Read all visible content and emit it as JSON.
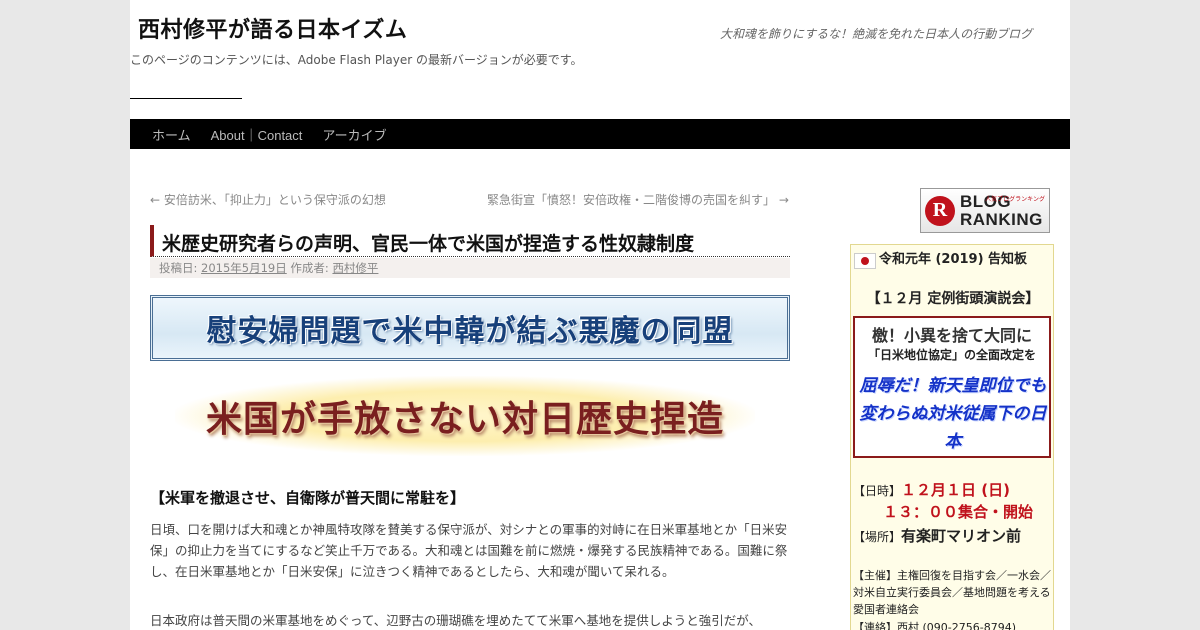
{
  "header": {
    "site_title": "西村修平が語る日本イズム",
    "site_description": "大和魂を飾りにするな！絶滅を免れた日本人の行動ブログ",
    "flash_message": "このページのコンテンツには、Adobe Flash Player の最新バージョンが必要です。"
  },
  "nav": {
    "items": [
      {
        "label": "ホーム"
      },
      {
        "label": "About｜Contact"
      },
      {
        "label": "アーカイブ"
      }
    ]
  },
  "post_nav": {
    "previous": "← 安倍訪米、「抑止力」という保守派の幻想",
    "next": "緊急街宣「憤怒！安倍政権・二階俊博の売国を糾す」 →"
  },
  "post": {
    "title": "米歴史研究者らの声明、官民一体で米国が捏造する性奴隷制度",
    "meta_prefix": "投稿日:",
    "date": "2015年5月19日",
    "author_prefix": "作成者:",
    "author": "西村修平",
    "banner1": "慰安婦問題で米中韓が結ぶ悪魔の同盟",
    "banner2": "米国が手放さない対日歴史捏造",
    "section_heading": "【米軍を撤退させ、自衛隊が普天間に常駐を】",
    "paragraph1": "日頃、口を開けば大和魂とか神風特攻隊を賛美する保守派が、対シナとの軍事的対峙に在日米軍基地とか「日米安保」の抑止力を当てにするなど笑止千万である。大和魂とは国難を前に燃焼・爆発する民族精神である。国難に祭し、在日米軍基地とか「日米安保」に泣きつく精神であるとしたら、大和魂が聞いて呆れる。",
    "paragraph2": "日本政府は普天間の米軍基地をめぐって、辺野古の珊瑚礁を埋めたてて米軍へ基地を提供しようと強引だが、"
  },
  "sidebar": {
    "ranking": {
      "line1": "BLOG",
      "line2": "RANKING",
      "small": "人気ブログランキング",
      "letter": "R"
    },
    "notice": {
      "title": "令和元年 (2019) 告知板",
      "event": "【１２月 定例街頭演説会】",
      "box_line1": "檄！小異を捨て大同に",
      "box_line2": "「日米地位協定」の全面改定を",
      "box_line3": "屈辱だ！新天皇即位でも変わらぬ対米従属下の日本",
      "date_label": "【日時】",
      "date_value": "１２月１日 (日)",
      "time_value": "１３：００集合・開始",
      "place_label": "【場所】",
      "place_value": "有楽町マリオン前",
      "organizer": "【主催】主権回復を目指す会／一水会／対米自立実行委員会／基地問題を考える愛国者連絡会",
      "contact": "【連絡】西村 (090-2756-8794)"
    }
  },
  "colors": {
    "nav_bg": "#000000",
    "title_accent": "#8b1a1a",
    "notice_bg": "#fffde8",
    "emphasis_red": "#c0121c",
    "emphasis_blue": "#1432c8"
  }
}
